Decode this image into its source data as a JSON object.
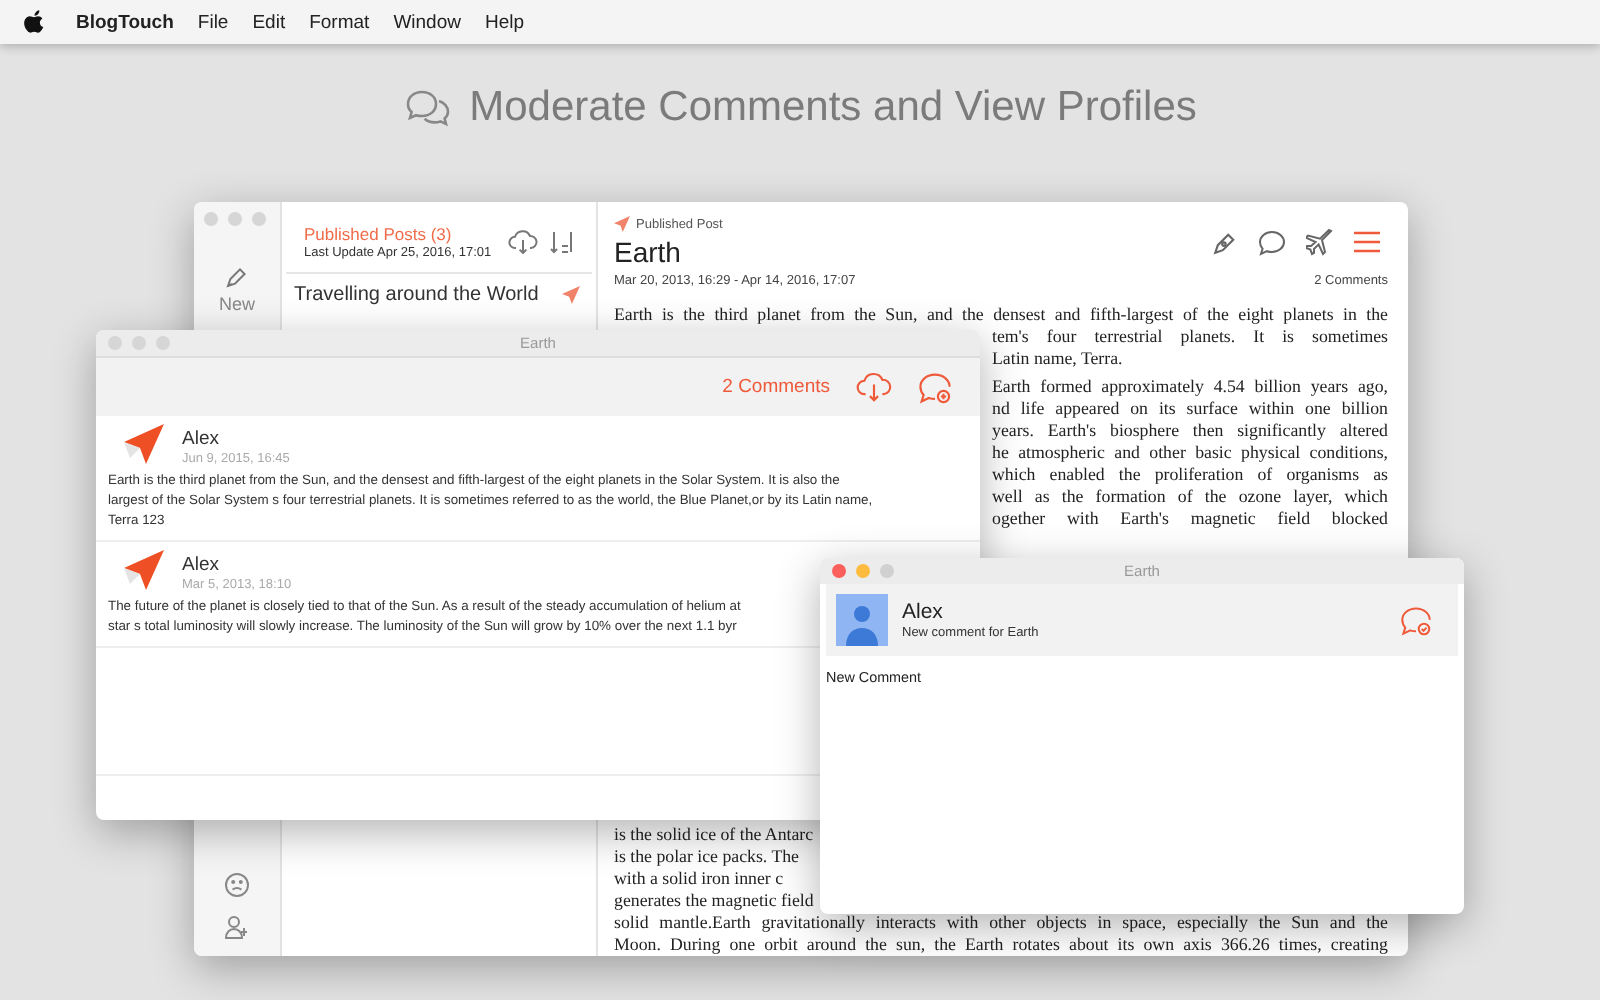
{
  "menu_bar": {
    "app": "BlogTouch",
    "items": [
      "File",
      "Edit",
      "Format",
      "Window",
      "Help"
    ]
  },
  "headline": "Moderate Comments and View Profiles",
  "main_window": {
    "active": false,
    "sidebar": {
      "new_label": "New"
    },
    "posts": {
      "title": "Published Posts (3)",
      "updated": "Last Update Apr 25, 2016, 17:01",
      "items": [
        {
          "title": "Travelling around the World"
        }
      ]
    },
    "post": {
      "status": "Published Post",
      "title": "Earth",
      "dates": "Mar 20, 2013, 16:29 - Apr 14, 2016, 17:07",
      "comment_count": "2 Comments",
      "article_top": [
        {
          "kind": "full",
          "text": "Earth is the third planet from the Sun, and the densest and fifth-largest of the eight planets in the"
        },
        {
          "kind": "right",
          "text": "tem's four terrestrial planets. It is sometimes"
        },
        {
          "kind": "right-last",
          "text": "Latin name, Terra."
        },
        {
          "kind": "gap",
          "text": "Earth formed approximately 4.54 billion years ago,"
        },
        {
          "kind": "right",
          "text": "nd life appeared on its surface within one billion"
        },
        {
          "kind": "right",
          "text": "years. Earth's biosphere then significantly altered"
        },
        {
          "kind": "right",
          "text": "he atmospheric and other basic physical conditions,"
        },
        {
          "kind": "right",
          "text": "which enabled the proliferation of organisms as"
        },
        {
          "kind": "right",
          "text": "well as the formation of the ozone layer, which"
        },
        {
          "kind": "right",
          "text": "ogether with Earth's magnetic field blocked"
        }
      ],
      "article_bottom": [
        {
          "kind": "left",
          "text": "is the solid ice of the Antarc"
        },
        {
          "kind": "left",
          "text": "is the polar ice packs. The"
        },
        {
          "kind": "left",
          "text": "with a solid iron inner c"
        },
        {
          "kind": "left",
          "text": "generates the magnetic field"
        },
        {
          "kind": "full",
          "text": "solid mantle.Earth gravitationally interacts with other objects in space, especially the Sun and the"
        },
        {
          "kind": "full",
          "text": "Moon. During one orbit around the sun, the Earth rotates about its own axis 366.26 times, creating"
        }
      ]
    }
  },
  "comments_window": {
    "active": false,
    "title": "Earth",
    "count": "2 Comments",
    "comments": [
      {
        "author": "Alex",
        "date": "Jun 9, 2015, 16:45",
        "lines": [
          "Earth is the third planet from the Sun, and the densest and fifth-largest of the eight planets in the Solar System. It is also the",
          "largest of the Solar System s four terrestrial planets. It is sometimes referred to as the world, the Blue Planet,or by its Latin name,",
          "Terra 123"
        ]
      },
      {
        "author": "Alex",
        "date": "Mar 5, 2013, 18:10",
        "lines": [
          "The future of the planet is closely tied to that of the Sun. As a result of the steady accumulation of helium at",
          "star s total luminosity will slowly increase. The luminosity of the Sun will grow by 10% over the next 1.1 byr"
        ]
      }
    ]
  },
  "new_comment_window": {
    "active": true,
    "title": "Earth",
    "author": "Alex",
    "subtitle": "New comment for Earth",
    "body": "New Comment"
  }
}
